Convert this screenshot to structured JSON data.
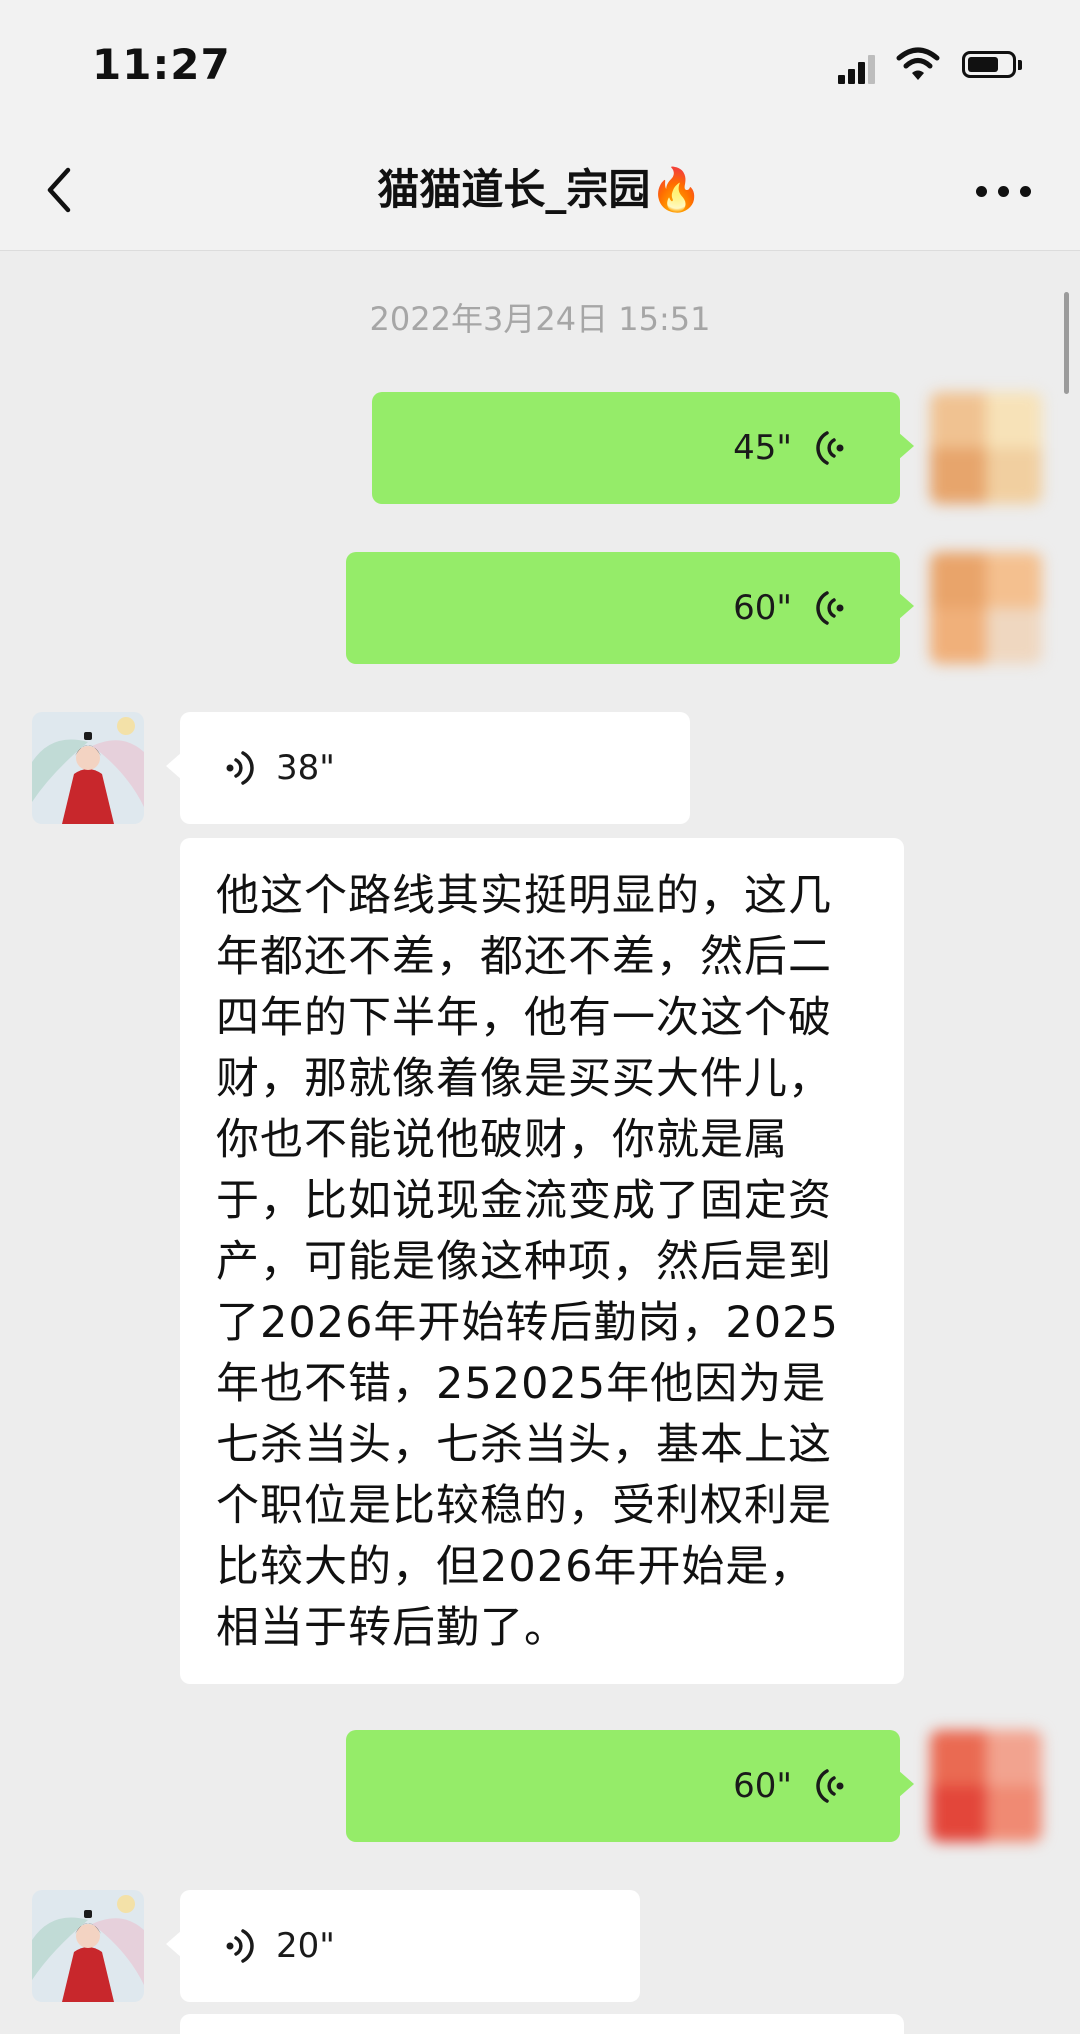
{
  "status_bar": {
    "time": "11:27"
  },
  "header": {
    "title": "猫猫道长_宗园🔥"
  },
  "chat": {
    "timestamp": "2022年3月24日 15:51",
    "messages": [
      {
        "direction": "out",
        "type": "voice",
        "duration": "45\""
      },
      {
        "direction": "out",
        "type": "voice",
        "duration": "60\""
      },
      {
        "direction": "in",
        "type": "voice",
        "duration": "38\""
      },
      {
        "direction": "in",
        "type": "text",
        "lines": [
          "他这个路线其实挺明显的，这几",
          "年都还不差，都还不差，然后二",
          "四年的下半年，他有一次这个破",
          "财，那就像着像是买买大件儿，",
          "你也不能说他破财，你就是属",
          "于，比如说现金流变成了固定资",
          "产，可能是像这种项，然后是到",
          "了2026年开始转后勤岗，2025",
          "年也不错，252025年他因为是",
          "七杀当头，七杀当头，基本上这",
          "个职位是比较稳的，受利权利是",
          "比较大的，但2026年开始是，",
          "相当于转后勤了。"
        ]
      },
      {
        "direction": "out",
        "type": "voice",
        "duration": "60\""
      },
      {
        "direction": "in",
        "type": "voice",
        "duration": "20\""
      }
    ]
  },
  "colors": {
    "outgoing_bubble": "#95ec69",
    "incoming_bubble": "#ffffff",
    "background": "#ededed",
    "timestamp_text": "#a6a6a6"
  },
  "icons": {
    "back": "chevron-left-icon",
    "more": "more-dots-icon",
    "voice": "voice-wave-icon"
  }
}
